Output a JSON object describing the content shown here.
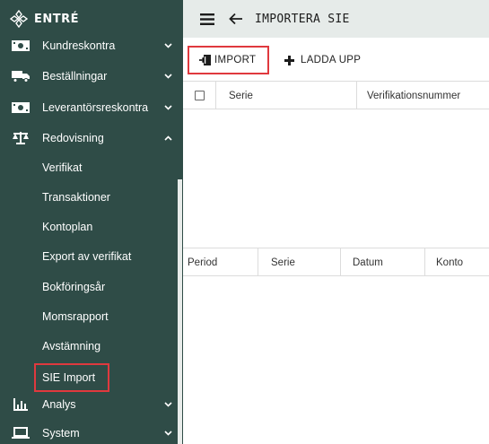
{
  "app": {
    "brand": "ENTRÉ"
  },
  "sidebar": {
    "items": [
      {
        "label": "Kundreskontra",
        "icon": "money-icon"
      },
      {
        "label": "Beställningar",
        "icon": "truck-icon"
      },
      {
        "label": "Leverantörsreskontra",
        "icon": "money-icon"
      },
      {
        "label": "Redovisning",
        "icon": "scale-icon",
        "expanded": true
      },
      {
        "label": "Analys",
        "icon": "chart-icon"
      },
      {
        "label": "System",
        "icon": "laptop-icon"
      }
    ],
    "subitems": [
      {
        "label": "Verifikat"
      },
      {
        "label": "Transaktioner"
      },
      {
        "label": "Kontoplan"
      },
      {
        "label": "Export av verifikat"
      },
      {
        "label": "Bokföringsår"
      },
      {
        "label": "Momsrapport"
      },
      {
        "label": "Avstämning"
      },
      {
        "label": "SIE Import",
        "active": true
      }
    ]
  },
  "header": {
    "title": "IMPORTERA SIE"
  },
  "toolbar": {
    "import_label": "IMPORT",
    "upload_label": "LADDA UPP"
  },
  "table1": {
    "columns": [
      "Serie",
      "Verifikationsnummer"
    ]
  },
  "table2": {
    "columns": [
      "Period",
      "Serie",
      "Datum",
      "Konto"
    ]
  },
  "colors": {
    "sidebar_bg": "#2f4c47",
    "topbar_bg": "#e6ebe9",
    "highlight": "#e0393e"
  }
}
